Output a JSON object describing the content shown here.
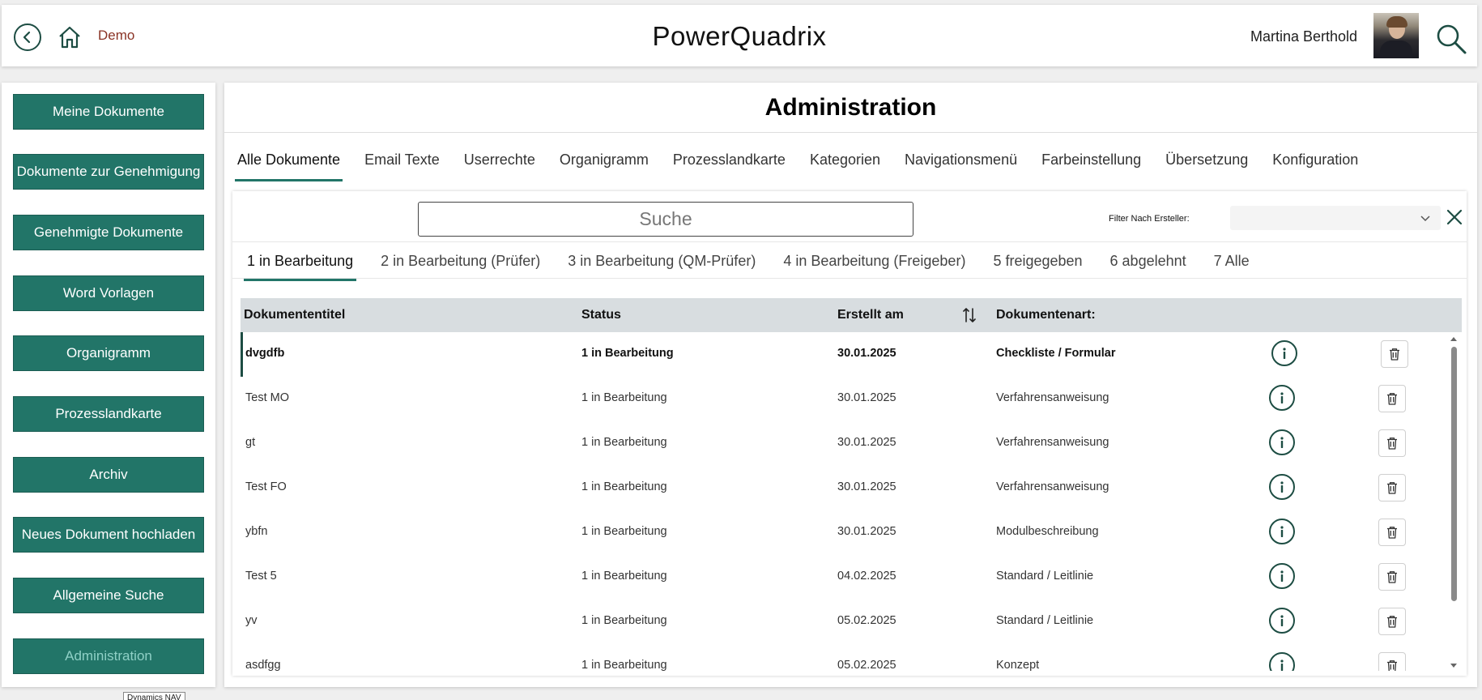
{
  "header": {
    "demo_label": "Demo",
    "app_title": "PowerQuadrix",
    "user_name": "Martina Berthold"
  },
  "sidebar": {
    "items": [
      {
        "label": "Meine Dokumente"
      },
      {
        "label": "Dokumente zur Genehmigung"
      },
      {
        "label": "Genehmigte Dokumente"
      },
      {
        "label": "Word Vorlagen"
      },
      {
        "label": "Organigramm"
      },
      {
        "label": "Prozesslandkarte"
      },
      {
        "label": "Archiv"
      },
      {
        "label": "Neues Dokument hochladen"
      },
      {
        "label": "Allgemeine Suche"
      },
      {
        "label": "Administration"
      }
    ],
    "tooltip": "Dynamics NAV"
  },
  "main": {
    "title": "Administration",
    "tabs": [
      {
        "label": "Alle Dokumente"
      },
      {
        "label": "Email Texte"
      },
      {
        "label": "Userrechte"
      },
      {
        "label": "Organigramm"
      },
      {
        "label": "Prozesslandkarte"
      },
      {
        "label": "Kategorien"
      },
      {
        "label": "Navigationsmenü"
      },
      {
        "label": "Farbeinstellung"
      },
      {
        "label": "Übersetzung"
      },
      {
        "label": "Konfiguration"
      }
    ],
    "search": {
      "placeholder": "Suche",
      "value": ""
    },
    "filter": {
      "label": "Filter Nach Ersteller:",
      "value": ""
    },
    "status_tabs": [
      {
        "label": "1 in Bearbeitung"
      },
      {
        "label": "2 in Bearbeitung (Prüfer)"
      },
      {
        "label": "3 in Bearbeitung (QM-Prüfer)"
      },
      {
        "label": "4 in Bearbeitung (Freigeber)"
      },
      {
        "label": "5 freigegeben"
      },
      {
        "label": "6 abgelehnt"
      },
      {
        "label": "7 Alle"
      }
    ],
    "table": {
      "columns": [
        "Dokumententitel",
        "Status",
        "Erstellt am",
        "Dokumentenart:"
      ],
      "rows": [
        {
          "title": "dvgdfb",
          "status": "1 in Bearbeitung",
          "created": "30.01.2025",
          "type": "Checkliste / Formular"
        },
        {
          "title": "Test MO",
          "status": "1 in Bearbeitung",
          "created": "30.01.2025",
          "type": "Verfahrensanweisung"
        },
        {
          "title": "gt",
          "status": "1 in Bearbeitung",
          "created": "30.01.2025",
          "type": "Verfahrensanweisung"
        },
        {
          "title": "Test FO",
          "status": "1 in Bearbeitung",
          "created": "30.01.2025",
          "type": "Verfahrensanweisung"
        },
        {
          "title": "ybfn",
          "status": "1 in Bearbeitung",
          "created": "30.01.2025",
          "type": "Modulbeschreibung"
        },
        {
          "title": "Test 5",
          "status": "1 in Bearbeitung",
          "created": "04.02.2025",
          "type": "Standard / Leitlinie"
        },
        {
          "title": "yv",
          "status": "1 in Bearbeitung",
          "created": "05.02.2025",
          "type": "Standard / Leitlinie"
        },
        {
          "title": "asdfgg",
          "status": "1 in Bearbeitung",
          "created": "05.02.2025",
          "type": "Konzept"
        }
      ]
    }
  },
  "colors": {
    "accent": "#227568",
    "dark_green": "#1d4d43",
    "demo_red": "#8a3325",
    "active_sidebar_text": "#8fd0c6",
    "table_header_bg": "#d8dde0"
  }
}
